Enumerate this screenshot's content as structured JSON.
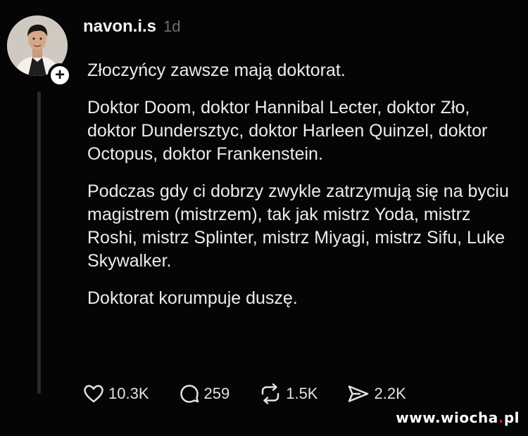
{
  "post": {
    "username": "navon.i.s",
    "timestamp": "1d",
    "follow_icon": "plus-icon",
    "paragraphs": [
      "Złoczyńcy zawsze mają doktorat.",
      "Doktor Doom, doktor Hannibal Lecter, doktor Zło, doktor Dundersztyc, doktor Harleen Quinzel, doktor Octopus, doktor Frankenstein.",
      "Podczas gdy ci dobrzy zwykle zatrzymują się na byciu magistrem (mistrzem), tak jak mistrz Yoda, mistrz Roshi, mistrz Splinter, mistrz Miyagi, mistrz Sifu, Luke Skywalker.",
      "Doktorat korumpuje duszę."
    ],
    "actions": {
      "likes": "10.3K",
      "replies": "259",
      "reposts": "1.5K",
      "shares": "2.2K"
    }
  },
  "watermark": {
    "prefix": "www.",
    "site": "wiocha",
    "dot": ".",
    "tld": "pl"
  },
  "colors": {
    "background": "#050505",
    "text": "#ececec",
    "muted": "#6e6e6e",
    "watermark_accent": "#d62323"
  }
}
